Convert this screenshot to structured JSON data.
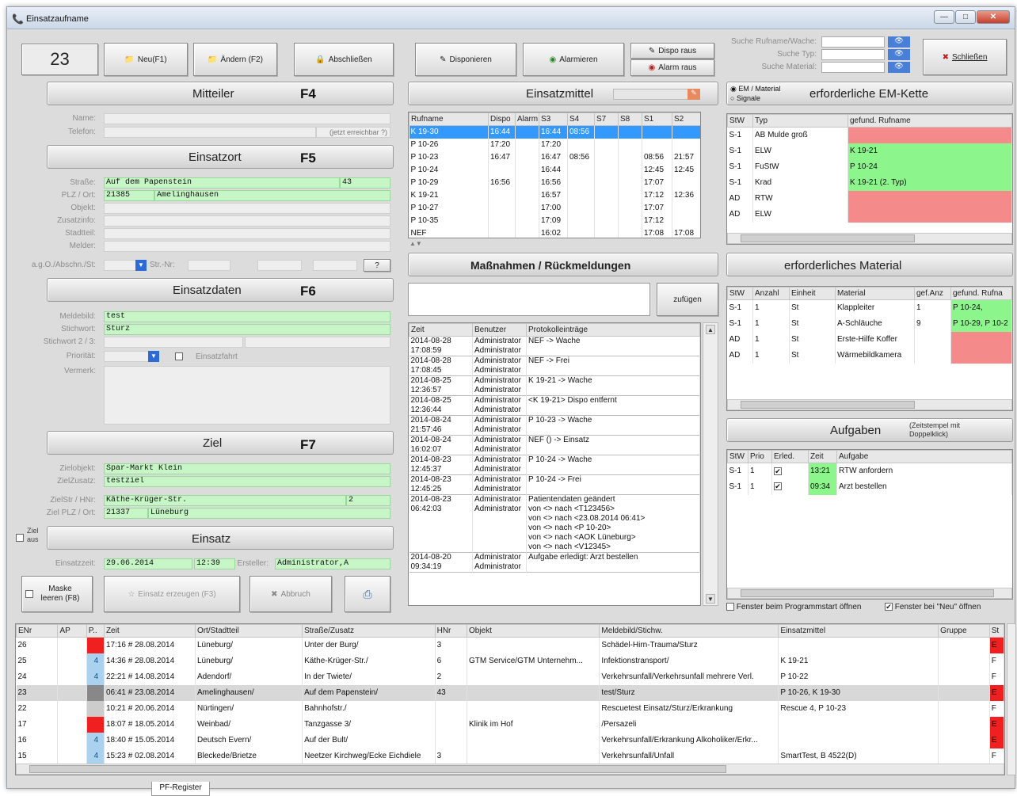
{
  "window": {
    "title": "Einsatzaufname",
    "controls": [
      "—",
      "□",
      "✕"
    ]
  },
  "einsatz_nr": "23",
  "buttons": {
    "neu": "Neu(F1)",
    "aendern": "Ändern (F2)",
    "abschliessen": "Abschließen",
    "disponieren": "Disponieren",
    "alarmieren": "Alarmieren",
    "dispo_raus": "Dispo raus",
    "alarm_raus": "Alarm raus",
    "schliessen": "Schließen",
    "einsatz_erzeugen": "Einsatz erzeugen (F3)",
    "abbruch": "Abbruch",
    "maske_leeren": "Maske leeren (F8)",
    "zufuegen": "zufügen"
  },
  "search": {
    "rufname": "Suche Rufname/Wache:",
    "typ": "Suche Typ:",
    "material": "Suche Material:"
  },
  "sections": {
    "mitteiler": "Mitteiler",
    "mitteiler_key": "F4",
    "einsatzort": "Einsatzort",
    "einsatzort_key": "F5",
    "einsatzdaten": "Einsatzdaten",
    "einsatzdaten_key": "F6",
    "ziel": "Ziel",
    "ziel_key": "F7",
    "einsatz": "Einsatz",
    "einsatzmittel": "Einsatzmittel",
    "massnahmen": "Maßnahmen / Rückmeldungen",
    "em_kette": "erforderliche EM-Kette",
    "material": "erforderliches Material",
    "aufgaben": "Aufgaben",
    "aufgaben_hint": "(Zeitstempel mit Doppelklick)",
    "em_material": "EM / Material",
    "signale": "Signale"
  },
  "mitteiler": {
    "name_label": "Name:",
    "telefon_label": "Telefon:",
    "erreichbar": "(jetzt erreichbar ?)"
  },
  "ort": {
    "strasse_label": "Straße:",
    "strasse": "Auf dem Papenstein",
    "hnr": "43",
    "plz_label": "PLZ / Ort:",
    "plz": "21385",
    "ort": "Amelinghausen",
    "objekt_label": "Objekt:",
    "zusatzinfo_label": "Zusatzinfo:",
    "stadtteil_label": "Stadtteil:",
    "melder_label": "Melder:",
    "agd_label": "a.g.O./Abschn./St:",
    "strnr_label": "Str.-Nr:",
    "q": "?"
  },
  "daten": {
    "meldebild_label": "Meldebild:",
    "meldebild": "test",
    "stichwort_label": "Stichwort:",
    "stichwort": "Sturz",
    "stichwort23_label": "Stichwort 2 / 3:",
    "prioritaet_label": "Priorität:",
    "einsatzfahrt": "Einsatzfahrt",
    "vermerk_label": "Vermerk:"
  },
  "ziel": {
    "objekt_label": "Zielobjekt:",
    "objekt": "Spar-Markt Klein",
    "zusatz_label": "ZielZusatz:",
    "zusatz": "testziel",
    "str_label": "ZielStr / HNr:",
    "str": "Käthe-Krüger-Str.",
    "hnr": "2",
    "plz_label": "Ziel PLZ / Ort:",
    "plz": "21337",
    "ort": "Lüneburg",
    "ziel_aus": "Ziel aus"
  },
  "einsatz": {
    "zeit_label": "Einsatzzeit:",
    "datum": "29.06.2014",
    "zeit": "12:39",
    "ersteller_label": "Ersteller:",
    "ersteller": "Administrator,A"
  },
  "em_table": {
    "headers": [
      "Rufname",
      "Dispo",
      "Alarm",
      "S3",
      "S4",
      "S7",
      "S8",
      "S1",
      "S2"
    ],
    "rows": [
      [
        "K 19-30",
        "16:44",
        "",
        "16:44",
        "08:56",
        "",
        "",
        "",
        ""
      ],
      [
        "P 10-26",
        "17:20",
        "",
        "17:20",
        "",
        "",
        "",
        "",
        ""
      ],
      [
        "P 10-23",
        "16:47",
        "",
        "16:47",
        "08:56",
        "",
        "",
        "08:56",
        "21:57"
      ],
      [
        "P 10-24",
        "",
        "",
        "16:44",
        "",
        "",
        "",
        "12:45",
        "12:45"
      ],
      [
        "P 10-29",
        "16:56",
        "",
        "16:56",
        "",
        "",
        "",
        "17:07",
        ""
      ],
      [
        "K 19-21",
        "",
        "",
        "16:57",
        "",
        "",
        "",
        "17:12",
        "12:36"
      ],
      [
        "P 10-27",
        "",
        "",
        "17:00",
        "",
        "",
        "",
        "17:07",
        ""
      ],
      [
        "P 10-35",
        "",
        "",
        "17:09",
        "",
        "",
        "",
        "17:12",
        ""
      ],
      [
        "NEF",
        "",
        "",
        "16:02",
        "",
        "",
        "",
        "17:08",
        "17:08"
      ]
    ]
  },
  "log": {
    "headers": [
      "Zeit",
      "Benutzer",
      "Protokolleinträge"
    ],
    "rows": [
      {
        "z1": "2014-08-28",
        "z2": "17:08:59",
        "u": "Administrator",
        "e": [
          "NEF -> Wache"
        ]
      },
      {
        "z1": "2014-08-28",
        "z2": "17:08:45",
        "u": "Administrator",
        "e": [
          "NEF -> Frei"
        ]
      },
      {
        "z1": "2014-08-25",
        "z2": "12:36:57",
        "u": "Administrator",
        "e": [
          "K 19-21 -> Wache"
        ]
      },
      {
        "z1": "2014-08-25",
        "z2": "12:36:44",
        "u": "Administrator",
        "e": [
          "<K 19-21> Dispo entfernt"
        ]
      },
      {
        "z1": "2014-08-24",
        "z2": "21:57:46",
        "u": "Administrator",
        "e": [
          "P 10-23 -> Wache"
        ]
      },
      {
        "z1": "2014-08-24",
        "z2": "16:02:07",
        "u": "Administrator",
        "e": [
          "NEF () -> Einsatz"
        ]
      },
      {
        "z1": "2014-08-23",
        "z2": "12:45:37",
        "u": "Administrator",
        "e": [
          "P 10-24 -> Wache"
        ]
      },
      {
        "z1": "2014-08-23",
        "z2": "12:45:25",
        "u": "Administrator",
        "e": [
          "P 10-24 -> Frei"
        ]
      },
      {
        "z1": "2014-08-23",
        "z2": "06:42:03",
        "u": "Administrator",
        "e": [
          "Patientendaten geändert",
          "von <> nach <T123456>",
          "von <> nach <23.08.2014 06:41>",
          "von <> nach <P 10-20>",
          "von <> nach <AOK Lüneburg>",
          "von <> nach <V12345>"
        ]
      },
      {
        "z1": "2014-08-20",
        "z2": "09:34:19",
        "u": "Administrator",
        "e": [
          "Aufgabe erledigt: Arzt bestellen"
        ]
      }
    ]
  },
  "kette": {
    "headers": [
      "StW",
      "Typ",
      "gefund. Rufname"
    ],
    "rows": [
      [
        "S-1",
        "AB Mulde groß",
        "",
        "r"
      ],
      [
        "S-1",
        "ELW",
        "K 19-21",
        "g"
      ],
      [
        "S-1",
        "FuStW",
        "P 10-24",
        "g"
      ],
      [
        "S-1",
        "Krad",
        "K 19-21 (2. Typ)",
        "g"
      ],
      [
        "AD",
        "RTW",
        "",
        "r"
      ],
      [
        "AD",
        "ELW",
        "",
        "r"
      ]
    ]
  },
  "material": {
    "headers": [
      "StW",
      "Anzahl",
      "Einheit",
      "Material",
      "gef.Anz",
      "gefund. Rufna"
    ],
    "rows": [
      [
        "S-1",
        "1",
        "St",
        "Klappleiter",
        "1",
        "P 10-24,",
        "g"
      ],
      [
        "S-1",
        "1",
        "St",
        "A-Schläuche",
        "9",
        "P 10-29, P 10-2",
        "g"
      ],
      [
        "AD",
        "1",
        "St",
        "Erste-Hilfe Koffer",
        "",
        "",
        "r"
      ],
      [
        "AD",
        "1",
        "St",
        "Wärmebildkamera",
        "",
        "",
        "r"
      ]
    ]
  },
  "aufgaben": {
    "headers": [
      "StW",
      "Prio",
      "Erled.",
      "Zeit",
      "Aufgabe"
    ],
    "rows": [
      [
        "S-1",
        "1",
        "✔",
        "13:21",
        "RTW anfordern"
      ],
      [
        "S-1",
        "1",
        "✔",
        "09:34",
        "Arzt bestellen"
      ]
    ]
  },
  "options": {
    "start": "Fenster beim Programmstart öffnen",
    "neu": "Fenster bei \"Neu\" öffnen"
  },
  "bottom": {
    "headers": [
      "ENr",
      "AP",
      "P..",
      "Zeit",
      "Ort/Stadtteil",
      "Straße/Zusatz",
      "HNr",
      "Objekt",
      "Meldebild/Stichw.",
      "Einsatzmittel",
      "Gruppe",
      "St"
    ],
    "rows": [
      [
        "26",
        "",
        "#f02020",
        "17:16 # 28.08.2014",
        "Lüneburg/",
        "Unter der Burg/",
        "3",
        "",
        "Schädel-Hirn-Trauma/Sturz",
        "",
        "",
        "E",
        "#f02020"
      ],
      [
        "25",
        "",
        "#aad2ee:4",
        "14:36 # 28.08.2014",
        "Lüneburg/",
        "Käthe-Krüger-Str./",
        "6",
        "GTM Service/GTM Unternehm...",
        "Infektionstransport/",
        "K 19-21",
        "",
        "F",
        ""
      ],
      [
        "24",
        "",
        "#aad2ee:4",
        "22:21 # 14.08.2014",
        "Adendorf/",
        "In der Twiete/",
        "2",
        "",
        "Verkehrsunfall/Verkehrsunfall mehrere Verl.",
        "P 10-22",
        "",
        "F",
        ""
      ],
      [
        "23",
        "",
        "#888888",
        "06:41 # 23.08.2014",
        "Amelinghausen/",
        "Auf dem Papenstein/",
        "43",
        "",
        "test/Sturz",
        "P 10-26, K 19-30",
        "",
        "E",
        "#f02020"
      ],
      [
        "22",
        "",
        "#cccccc",
        "10:21 # 20.06.2014",
        "Nürtingen/",
        "Bahnhofstr./",
        "",
        "",
        "Rescuetest Einsatz/Sturz/Erkrankung",
        "Rescue 4, P 10-23",
        "",
        "F",
        ""
      ],
      [
        "17",
        "",
        "#f02020",
        "18:07 # 18.05.2014",
        "Weinbad/",
        "Tanzgasse 3/",
        "",
        "Klinik im Hof",
        "/Persazeli",
        "",
        "",
        "E",
        "#f02020"
      ],
      [
        "16",
        "",
        "#aad2ee:4",
        "18:40 # 15.05.2014",
        "Deutsch Evern/",
        "Auf der Bult/",
        "",
        "",
        "Verkehrsunfall/Erkrankung Alkoholiker/Erkr...",
        "",
        "",
        "E",
        "#f02020"
      ],
      [
        "15",
        "",
        "#aad2ee:4",
        "15:23 # 02.08.2014",
        "Bleckede/Brietze",
        "Neetzer Kirchweg/Ecke Eichdiele",
        "3",
        "",
        "Verkehrsunfall/Unfall",
        "SmartTest, B 4522(D)",
        "",
        "F",
        ""
      ]
    ]
  },
  "tab": "PF-Register"
}
